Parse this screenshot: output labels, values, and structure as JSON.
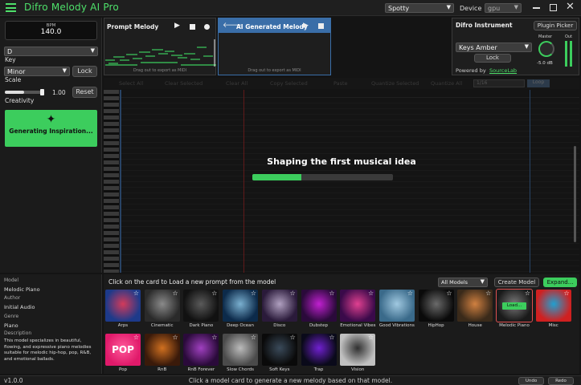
{
  "app": {
    "title": "Difro Melody AI Pro",
    "version": "v1.0.0"
  },
  "topbar": {
    "source_select": "Spotty",
    "device_label": "Device",
    "device_select": "gpu"
  },
  "left": {
    "bpm_label": "BPM",
    "bpm_value": "140.0",
    "key_value": "D",
    "key_label": "Key",
    "scale_value": "Minor",
    "lock_label": "Lock",
    "scale_label": "Scale",
    "creativity_value": "1.00",
    "reset_label": "Reset",
    "creativity_label": "Creativity",
    "creativity_level": 0.5,
    "generate_label": "Generating Inspiration..."
  },
  "model_info": {
    "model_label": "Model",
    "model_value": "Melodic Piano",
    "author_label": "Author",
    "author_value": "Initial Audio",
    "genre_label": "Genre",
    "genre_value": "Piano",
    "description_label": "Description",
    "description_value": "This model specializes in beautiful, flowing, and expressive piano melodies suitable for melodic hip-hop, pop, R&B, and emotional ballads."
  },
  "prompt_melody": {
    "title": "Prompt Melody",
    "drag_hint": "Drag out to export as MIDI"
  },
  "ai_melody": {
    "title": "AI Generated Melody",
    "drag_hint": "Drag out to export as MIDI"
  },
  "instrument": {
    "title": "Difro Instrument",
    "plugin_picker": "Plugin Picker",
    "preset": "Keys Amber",
    "lock_label": "Lock",
    "powered_by": "Powered by",
    "powered_link": "SourceLab",
    "master_label": "Master",
    "out_label": "Out",
    "db_value": "-5.0 dB"
  },
  "editor_toolbar": {
    "items": [
      "Select All",
      "Clear Selected",
      "Clear All",
      "Copy Selected",
      "Paste",
      "Quantize Selected",
      "Quantize All"
    ],
    "grid_value": "1/16",
    "loop_label": "Loop"
  },
  "overlay": {
    "message": "Shaping the first musical idea",
    "progress": 0.35
  },
  "models": {
    "hint": "Click on the card to Load a new prompt from the model",
    "filter": "All Models",
    "create_label": "Create Model",
    "expand_label": "Expand...",
    "load_label": "Load...",
    "cards": [
      {
        "name": "Arps",
        "c1": "#1d3a8a",
        "c2": "#d33a5a"
      },
      {
        "name": "Cinematic",
        "c1": "#2a2a2a",
        "c2": "#8a8a8a"
      },
      {
        "name": "Dark Piano",
        "c1": "#111111",
        "c2": "#5a5a5a"
      },
      {
        "name": "Deep Ocean",
        "c1": "#0c2a4a",
        "c2": "#7ab0d0"
      },
      {
        "name": "Disco",
        "c1": "#2a1a3a",
        "c2": "#b0a0c0"
      },
      {
        "name": "Dubstep",
        "c1": "#2a0a3a",
        "c2": "#c020d0"
      },
      {
        "name": "Emotional Vibes",
        "c1": "#3a0a4a",
        "c2": "#e04090"
      },
      {
        "name": "Good Vibrations",
        "c1": "#3a6a8a",
        "c2": "#a0c8e0"
      },
      {
        "name": "HipHop",
        "c1": "#0a0a0a",
        "c2": "#6a6a6a"
      },
      {
        "name": "House",
        "c1": "#3a2a1a",
        "c2": "#d08040"
      },
      {
        "name": "Melodic Piano",
        "c1": "#1a1a1a",
        "c2": "#7a7a7a"
      },
      {
        "name": "Misc",
        "c1": "#d02020",
        "c2": "#20a0d0"
      },
      {
        "name": "Pop",
        "c1": "#e01a6a",
        "c2": "#ff5a9a",
        "text": "POP"
      },
      {
        "name": "RnB",
        "c1": "#3a1a0a",
        "c2": "#d07020"
      },
      {
        "name": "RnB Forever",
        "c1": "#2a0a3a",
        "c2": "#a040c0"
      },
      {
        "name": "Slow Chords",
        "c1": "#4a4a4a",
        "c2": "#bbbbbb"
      },
      {
        "name": "Soft Keys",
        "c1": "#0a0a0a",
        "c2": "#3a4a5a"
      },
      {
        "name": "Trap",
        "c1": "#0a0a1a",
        "c2": "#7020d0"
      },
      {
        "name": "Vision",
        "c1": "#c0c0c0",
        "c2": "#303030"
      }
    ]
  },
  "status": {
    "message": "Click a model card to generate a new melody based on that model.",
    "undo": "Undo",
    "redo": "Redo"
  },
  "colors": {
    "accent": "#4ee06a",
    "ai_panel": "#3a6ea8"
  }
}
